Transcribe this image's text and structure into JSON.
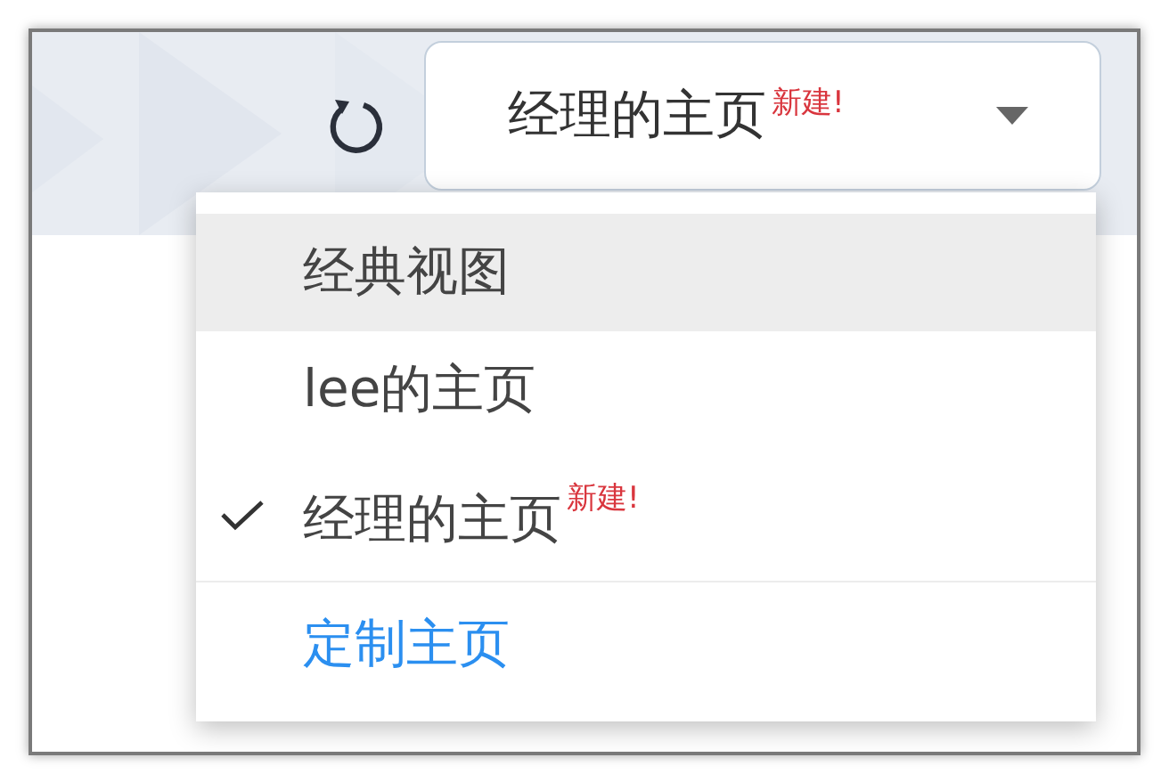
{
  "selector": {
    "label": "经理的主页",
    "badge": "新建!",
    "expanded": true
  },
  "menu": {
    "items": [
      {
        "kind": "option",
        "label": "经典视图",
        "selected": false,
        "highlighted": true
      },
      {
        "kind": "option",
        "label": "lee的主页",
        "selected": false,
        "highlighted": false
      },
      {
        "kind": "option",
        "label": "经理的主页",
        "badge": "新建!",
        "selected": true,
        "highlighted": false
      },
      {
        "kind": "action",
        "label": "定制主页",
        "selected": false,
        "highlighted": false
      }
    ]
  }
}
